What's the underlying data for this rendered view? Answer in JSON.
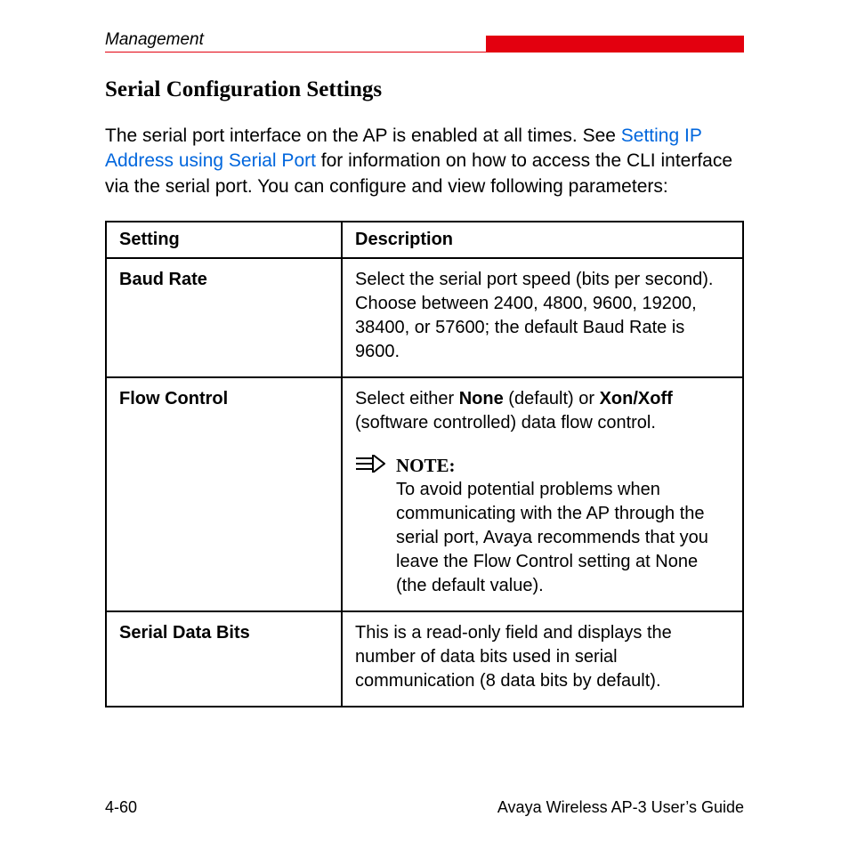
{
  "header": {
    "section": "Management"
  },
  "heading": "Serial Configuration Settings",
  "intro": {
    "pre": "The serial port interface on the AP is enabled at all times. See ",
    "link": "Setting IP Address using Serial Port",
    "post": " for information on how to access the CLI interface via the serial port. You can configure and view following parameters:"
  },
  "table": {
    "col1": "Setting",
    "col2": "Description",
    "rows": [
      {
        "name": "Baud Rate",
        "desc": "Select the serial port speed (bits per second). Choose between 2400, 4800, 9600, 19200, 38400, or 57600; the default Baud Rate is 9600."
      },
      {
        "name": "Flow Control",
        "desc_pre": "Select either ",
        "b1": "None",
        "mid1": " (default) or ",
        "b2": "Xon/Xoff",
        "desc_post": " (software controlled) data flow control.",
        "note_label": "NOTE:",
        "note_text": "To avoid potential problems when communicating with the AP through the serial port, Avaya recommends that you leave the Flow Control setting at None (the default value)."
      },
      {
        "name": "Serial Data Bits",
        "desc": "This is a read-only field and displays the number of data bits used in serial communication (8 data bits by default)."
      }
    ]
  },
  "footer": {
    "page": "4-60",
    "doc": "Avaya Wireless AP-3 User’s Guide"
  }
}
